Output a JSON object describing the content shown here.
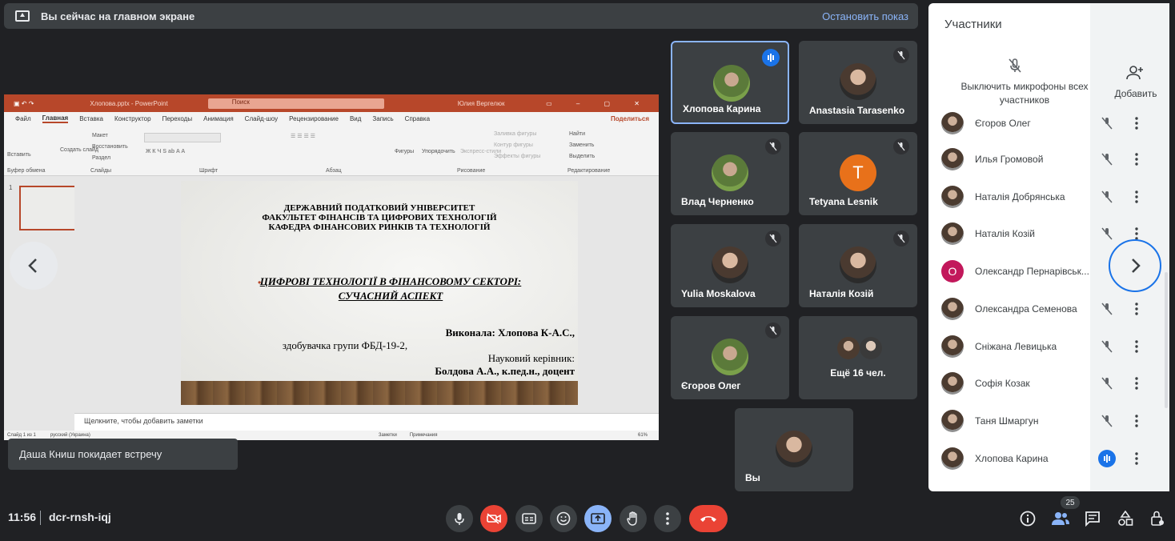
{
  "banner": {
    "text": "Вы сейчас на главном экране",
    "stop": "Остановить показ"
  },
  "ppt": {
    "filename": "Хлопова.pptx - PowerPoint",
    "search": "Поиск",
    "user": "Юлия Вергелюк",
    "tabs": [
      "Файл",
      "Главная",
      "Вставка",
      "Конструктор",
      "Переходы",
      "Анимация",
      "Слайд-шоу",
      "Рецензирование",
      "Вид",
      "Запись",
      "Справка"
    ],
    "share": "Поделиться",
    "ribbon_groups": [
      "Буфер обмена",
      "Слайды",
      "Шрифт",
      "Абзац",
      "Рисование",
      "Редактирование"
    ],
    "ribbon_items": [
      "Вставить",
      "Создать слайд",
      "Макет",
      "Восстановить",
      "Раздел",
      "Фигуры",
      "Упорядочить",
      "Экспресс-стили",
      "Заливка фигуры",
      "Контур фигуры",
      "Эффекты фигуры",
      "Найти",
      "Заменить",
      "Выделить"
    ],
    "slide_num": "1",
    "slide": {
      "l1": "ДЕРЖАВНИЙ ПОДАТКОВИЙ УНІВЕРСИТЕТ",
      "l2": "ФАКУЛЬТЕТ ФІНАНСІВ ТА ЦИФРОВИХ ТЕХНОЛОГІЙ",
      "l3": "КАФЕДРА ФІНАНСОВИХ РИНКІВ ТА ТЕХНОЛОГІЙ",
      "t1": "ЦИФРОВІ ТЕХНОЛОГІЇ В ФІНАНСОВОМУ СЕКТОРІ:",
      "t2": "СУЧАСНИЙ АСПЕКТ",
      "a1": "Виконала: Хлопова К-А.С.,",
      "a2": "здобувачка групи ФБД-19-2,",
      "a3": "Науковий керівник:",
      "a4": "Болдова А.А., к.пед.н., доцент"
    },
    "notes": "Щелкните, чтобы добавить заметки",
    "status_left": "Слайд 1 из 1",
    "status_lang": "русский (Украина)",
    "status_notes": "Заметки",
    "status_comments": "Примечания",
    "zoom": "61%"
  },
  "toast": "Даша Книш покидает встречу",
  "tiles": [
    {
      "name": "Хлопова Карина",
      "mic": "speaking"
    },
    {
      "name": "Anastasia Tarasenko",
      "mic": "muted"
    },
    {
      "name": "Влад Черненко",
      "mic": "muted"
    },
    {
      "name": "Tetyana Lesnik",
      "mic": "muted",
      "letter": "T"
    },
    {
      "name": "Yulia Moskalova",
      "mic": "muted"
    },
    {
      "name": "Наталія Козій",
      "mic": "muted"
    },
    {
      "name": "Єгоров Олег",
      "mic": "muted"
    },
    {
      "name": "Ещё 16 чел."
    },
    {
      "name": "Вы"
    }
  ],
  "panel": {
    "title": "Участники",
    "mute_all": "Выключить микрофоны всех участников",
    "add": "Добавить",
    "people": [
      {
        "name": "Єгоров Олег"
      },
      {
        "name": "Илья Громовой"
      },
      {
        "name": "Наталія Добрянська"
      },
      {
        "name": "Наталія Козій"
      },
      {
        "name": "Олександр Пернарівськ...",
        "letter": "О"
      },
      {
        "name": "Олександра Семенова"
      },
      {
        "name": "Сніжана Левицька"
      },
      {
        "name": "Софія Козак"
      },
      {
        "name": "Таня Шмаргун"
      },
      {
        "name": "Хлопова Карина",
        "speaking": true
      }
    ]
  },
  "bottom": {
    "time": "11:56",
    "code": "dcr-rnsh-iqj",
    "participants_count": "25"
  },
  "colors": {
    "accent": "#8ab4f8",
    "danger": "#ea4335",
    "ppt": "#b7472a",
    "speaking": "#1a73e8"
  }
}
